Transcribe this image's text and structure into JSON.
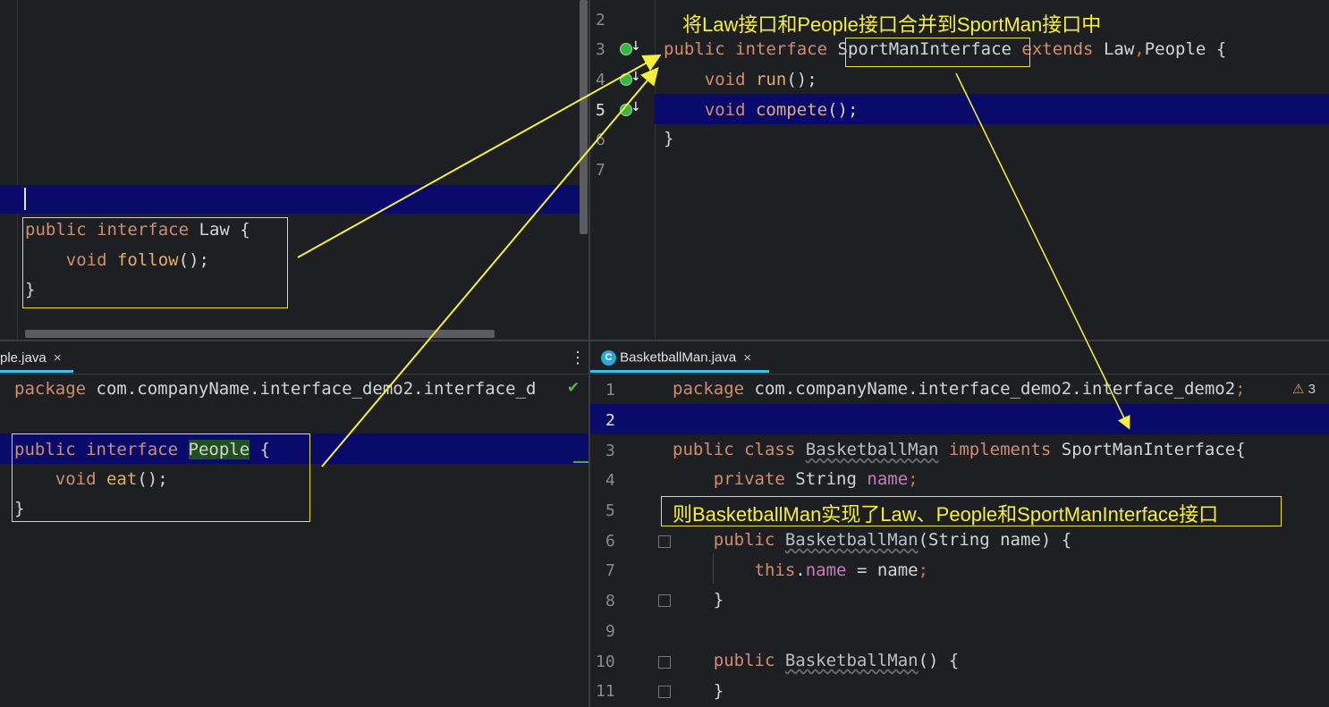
{
  "top_left": {
    "code": {
      "line1_kw1": "public",
      "line1_kw2": "interface",
      "line1_name": "Law",
      "line1_brace": "{",
      "line2_void": "void",
      "line2_fn": "follow",
      "line2_rest": "();",
      "line3": "}"
    }
  },
  "top_right": {
    "annotation": "将Law接口和People接口合并到SportMan接口中",
    "line_numbers": [
      "2",
      "3",
      "4",
      "5",
      "6",
      "7"
    ],
    "code": {
      "l3_kw1": "public",
      "l3_kw2": "interface",
      "l3_name": "SportManInterface",
      "l3_extends": "extends",
      "l3_parents_a": "Law",
      "l3_comma": ",",
      "l3_parents_b": "People",
      "l3_brace": "{",
      "l4_void": "void",
      "l4_fn": "run",
      "l4_rest": "();",
      "l5_void": "void",
      "l5_fn": "compete",
      "l5_rest": "();",
      "l6": "}"
    }
  },
  "bottom_left": {
    "tab_label": "ple.java",
    "tab_close": "×",
    "menu_dots": "⋮",
    "check": "✔",
    "code": {
      "pkg_kw": "package",
      "pkg_name": "com.companyName.interface_demo2.interface_d",
      "l3_kw1": "public",
      "l3_kw2": "interface",
      "l3_name": "People",
      "l3_brace": "{",
      "l4_void": "void",
      "l4_fn": "eat",
      "l4_rest": "();",
      "l5": "}"
    }
  },
  "bottom_right": {
    "tab_icon_letter": "C",
    "tab_label": "BasketballMan.java",
    "tab_close": "×",
    "warning_icon": "⚠",
    "warning_count": "3",
    "annotation": "则BasketballMan实现了Law、People和SportManInterface接口",
    "line_numbers": [
      "1",
      "2",
      "3",
      "4",
      "5",
      "6",
      "7",
      "8",
      "9",
      "10",
      "11"
    ],
    "code": {
      "l1_kw": "package",
      "l1_name": "com.companyName.interface_demo2.interface_demo2",
      "l1_semi": ";",
      "l3_kw1": "public",
      "l3_kw2": "class",
      "l3_name": "BasketballMan",
      "l3_impl": "implements",
      "l3_iface": "SportManInterface{",
      "l4_kw": "private",
      "l4_type": "String",
      "l4_field": "name",
      "l4_semi": ";",
      "l6_kw": "public",
      "l6_name": "BasketballMan",
      "l6_params": "(String name) {",
      "l7_this": "this",
      "l7_dot": ".",
      "l7_field": "name",
      "l7_rest": " = name",
      "l7_semi": ";",
      "l8": "}",
      "l10_kw": "public",
      "l10_name": "BasketballMan",
      "l10_rest": "() {",
      "l11": "}"
    }
  },
  "colors": {
    "background": "#1e1f22",
    "keyword": "#cf8e6d",
    "function": "#e0b06a",
    "field": "#c77dbb",
    "highlight_row": "#0a0a6b",
    "annotation": "#f5f040",
    "tab_underline": "#3ec0e6"
  }
}
